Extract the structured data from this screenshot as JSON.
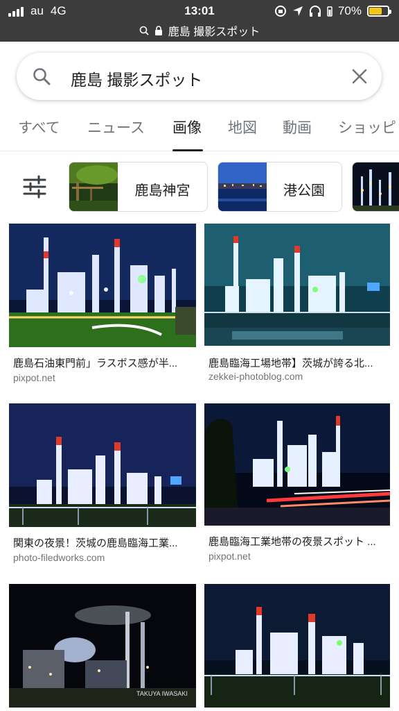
{
  "status_bar": {
    "carrier": "au",
    "network": "4G",
    "time": "13:01",
    "battery": "70%",
    "battery_level": 0.7,
    "battery_color": "#f5c518",
    "url": "鹿島 撮影スポット"
  },
  "search": {
    "query": "鹿島 撮影スポット",
    "search_icon": "search-icon",
    "clear_icon": "close-icon"
  },
  "tabs": [
    {
      "label": "すべて",
      "active": false
    },
    {
      "label": "ニュース",
      "active": false
    },
    {
      "label": "画像",
      "active": true
    },
    {
      "label": "地図",
      "active": false
    },
    {
      "label": "動画",
      "active": false
    },
    {
      "label": "ショッピ",
      "active": false
    }
  ],
  "chips": [
    {
      "label": "鹿島神宮",
      "thumb": "forest"
    },
    {
      "label": "港公園",
      "thumb": "harbor"
    },
    {
      "label": "",
      "thumb": "plant"
    }
  ],
  "results": [
    {
      "title": "鹿島石油東門前」ラスボス感が半...",
      "source": "pixpot.net"
    },
    {
      "title": "鹿島臨海工場地帯】茨城が誇る北...",
      "source": "zekkei-photoblog.com"
    },
    {
      "title": "関東の夜景！茨城の鹿島臨海工業...",
      "source": "photo-filedworks.com"
    },
    {
      "title": "鹿島臨海工業地帯の夜景スポット ...",
      "source": "pixpot.net"
    },
    {
      "title": "",
      "source": ""
    },
    {
      "title": "",
      "source": ""
    }
  ],
  "watermark": "TAKUYA IWASAKI",
  "colors": {
    "status_bar_bg": "#3c3c3c",
    "active_tab": "#202124",
    "secondary_text": "#70757a",
    "night_sky": "#0d1a3a",
    "plant_light": "#e8f0ff"
  }
}
